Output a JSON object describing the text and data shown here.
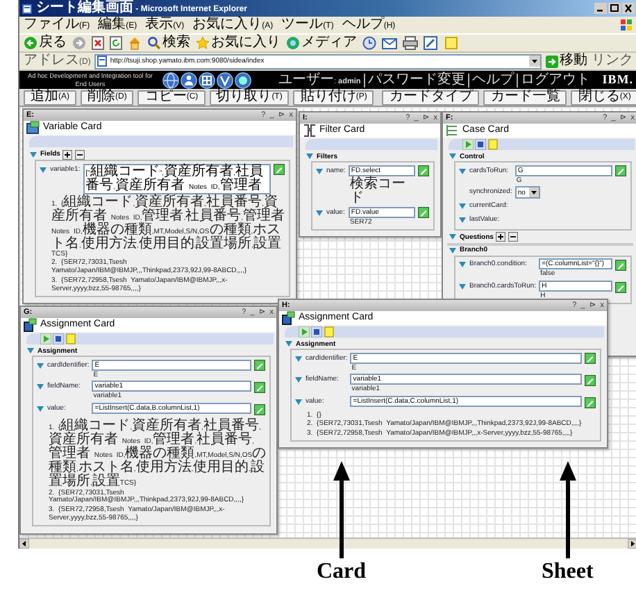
{
  "window": {
    "title": "シート編集画面 - Microsoft Internet Explorer"
  },
  "menu": [
    "ファイル(F)",
    "編集(E)",
    "表示(V)",
    "お気に入り(A)",
    "ツール(T)",
    "ヘルプ(H)"
  ],
  "toolbar": [
    "戻る",
    "検索",
    "お気に入り",
    "メディア"
  ],
  "address": {
    "label": "アドレス(D)",
    "value": "http://tsuji.shop.yamato.ibm.com:9080/sidea/index",
    "go": "移動",
    "links": "リンク"
  },
  "app_header": {
    "tagline": "Ad hoc Development and Integration tool for End Users",
    "user_links": [
      "ユーザー: **admin**",
      "パスワード変更",
      "ヘルプ",
      "ログアウト"
    ],
    "logo": "IBM."
  },
  "actions": [
    "追加(A)",
    "削除(D)",
    "コピー(C)",
    "切り取り(T)",
    "貼り付け(P)"
  ],
  "right_actions": [
    "カードタイプ",
    "カード一覧",
    "閉じる(X)"
  ],
  "cards": [
    {
      "id": "E:",
      "title": "Variable Card",
      "kind": "variable",
      "controls": [
        "?",
        "_",
        "⊳",
        "x"
      ],
      "tools": false,
      "sections": [
        {
          "title": "Fields",
          "add_remove": true,
          "fields": [
            {
              "kind": "input",
              "label": "variable1:",
              "value": "[\"組織コード\",資産所有者,社員番号,資産所有者 Notes ID,管理者",
              "results": [
                "1. {組織コード,資産所有者,社員番号,資産所有者 Notes ID,管理者,社員番号,管理者 Notes ID,機器の種類,MT,Model,S/N,OSの種類,ホスト名,使用方法,使用目的,設置場所,設置TCS}",
                "2. {SER72,73031,Tsesh Yamato/Japan/IBM@IBMJP,,,Thinkpad,2373,92J,99-8ABCD,,,,}",
                "3. {SER72,72958,Tsesh Yamato/Japan/IBM@IBMJP,,,x-Server,yyyy,bzz,55-98765,,,,}"
              ]
            }
          ]
        }
      ]
    },
    {
      "id": "I:",
      "title": "Filter Card",
      "kind": "filter",
      "controls": [
        "?",
        "_",
        "⊳",
        "x"
      ],
      "tools": false,
      "sections": [
        {
          "title": "Filters",
          "add_remove": false,
          "fields": [
            {
              "kind": "input",
              "label": "name:",
              "value": "FD.select",
              "result": "検索コード"
            },
            {
              "kind": "input",
              "label": "value:",
              "value": "FD.value",
              "result": "SER72"
            }
          ]
        }
      ]
    },
    {
      "id": "F:",
      "title": "Case Card",
      "kind": "case",
      "controls": [
        "?",
        "_",
        "⊳",
        "x"
      ],
      "tools": true,
      "sections": [
        {
          "title": "Control",
          "add_remove": false,
          "fields": [
            {
              "kind": "input",
              "label": "cardsToRun:",
              "value": "G",
              "result": "G"
            },
            {
              "kind": "select",
              "label": "synchronized:",
              "value": "no"
            },
            {
              "kind": "plain",
              "label": "currentCard:"
            },
            {
              "kind": "plain",
              "label": "lastValue:"
            }
          ]
        },
        {
          "title": "Questions",
          "add_remove": true
        },
        {
          "title": "Branch0",
          "add_remove": false,
          "fields": [
            {
              "kind": "input",
              "label": "Branch0.condition:",
              "value": "=(C.columnList=\"{}\")",
              "result": "false"
            },
            {
              "kind": "input",
              "label": "Branch0.cardsToRun:",
              "value": "H",
              "result": "H"
            }
          ]
        }
      ]
    },
    {
      "id": "G:",
      "title": "Assignment Card",
      "kind": "assignment",
      "controls": [
        "?",
        "_",
        "⊳",
        "x"
      ],
      "tools": true,
      "sections": [
        {
          "title": "Assignment",
          "add_remove": false,
          "fields": [
            {
              "kind": "input",
              "label": "cardIdentifier:",
              "value": "E",
              "result": "E"
            },
            {
              "kind": "input",
              "label": "fieldName:",
              "value": "variable1",
              "result": "variable1"
            },
            {
              "kind": "input",
              "label": "value:",
              "value": "=ListInsert(C.data,B.columnList,1)",
              "results": [
                "1. {組織コード,資産所有者,社員番号,資産所有者 Notes ID,管理者,社員番号,管理者 Notes ID,機器の種類,MT,Model,S/N,OSの種類,ホスト名,使用方法,使用目的,設置場所,設置TCS}",
                "2. {SER72,73031,Tsesh Yamato/Japan/IBM@IBMJP,,,Thinkpad,2373,92J,99-8ABCD,,,,}",
                "3. {SER72,72958,Tsesh Yamato/Japan/IBM@IBMJP,,,x-Server,yyyy,bzz,55-98765,,,,}"
              ]
            }
          ]
        }
      ]
    },
    {
      "id": "H:",
      "title": "Assignment Card",
      "kind": "assignment",
      "controls": [
        "?",
        "_",
        "⊳",
        "x"
      ],
      "tools": true,
      "sections": [
        {
          "title": "Assignment",
          "add_remove": false,
          "fields": [
            {
              "kind": "input",
              "label": "cardIdentifier:",
              "value": "E",
              "result": "E"
            },
            {
              "kind": "input",
              "label": "fieldName:",
              "value": "variable1",
              "result": "variable1"
            },
            {
              "kind": "input",
              "label": "value:",
              "value": "=ListInsert(C.data,C.columnList,1)",
              "results": [
                "1. {}",
                "2. {SER72,73031,Tsesh Yamato/Japan/IBM@IBMJP,,,Thinkpad,2373,92J,99-8ABCD,,,,}",
                "3. {SER72,72958,Tsesh Yamato/Japan/IBM@IBMJP,,,x-Server,yyyy,bzz,55-98765,,,,}"
              ]
            }
          ]
        }
      ]
    }
  ],
  "annotations": [
    {
      "label": "Card"
    },
    {
      "label": "Sheet"
    }
  ]
}
